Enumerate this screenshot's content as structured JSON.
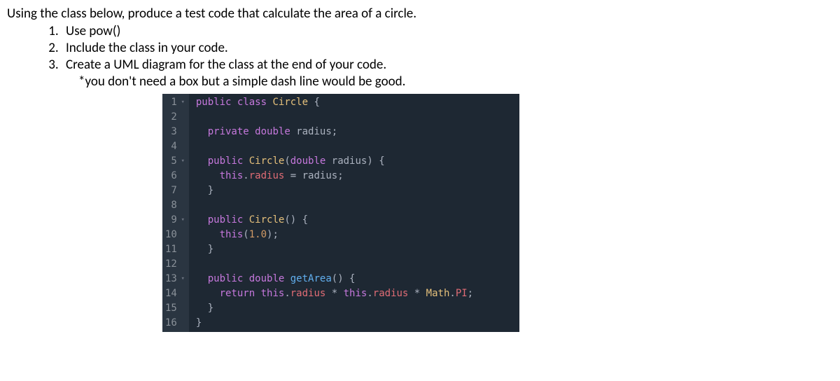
{
  "instruction": "Using the class below, produce a test code that calculate the area of a circle.",
  "list_items": [
    "Use pow()",
    "Include the class in your code.",
    "Create a UML diagram for the class at the end of your code."
  ],
  "note": "*you don't need a box but a simple dash line would be good.",
  "code": {
    "lines": [
      {
        "num": "1",
        "fold": true,
        "tokens": [
          {
            "t": "public",
            "c": "kw"
          },
          {
            "t": " ",
            "c": ""
          },
          {
            "t": "class",
            "c": "kw"
          },
          {
            "t": " ",
            "c": ""
          },
          {
            "t": "Circle",
            "c": "cls"
          },
          {
            "t": " {",
            "c": "punct"
          }
        ]
      },
      {
        "num": "2",
        "fold": false,
        "tokens": []
      },
      {
        "num": "3",
        "fold": false,
        "tokens": [
          {
            "t": "  ",
            "c": ""
          },
          {
            "t": "private",
            "c": "kw"
          },
          {
            "t": " ",
            "c": ""
          },
          {
            "t": "double",
            "c": "type"
          },
          {
            "t": " ",
            "c": ""
          },
          {
            "t": "radius",
            "c": "ident"
          },
          {
            "t": ";",
            "c": "punct"
          }
        ]
      },
      {
        "num": "4",
        "fold": false,
        "tokens": []
      },
      {
        "num": "5",
        "fold": true,
        "tokens": [
          {
            "t": "  ",
            "c": ""
          },
          {
            "t": "public",
            "c": "kw"
          },
          {
            "t": " ",
            "c": ""
          },
          {
            "t": "Circle",
            "c": "cls"
          },
          {
            "t": "(",
            "c": "punct"
          },
          {
            "t": "double",
            "c": "type"
          },
          {
            "t": " ",
            "c": ""
          },
          {
            "t": "radius",
            "c": "ident"
          },
          {
            "t": ") {",
            "c": "punct"
          }
        ]
      },
      {
        "num": "6",
        "fold": false,
        "tokens": [
          {
            "t": "    ",
            "c": ""
          },
          {
            "t": "this",
            "c": "this"
          },
          {
            "t": ".",
            "c": "punct"
          },
          {
            "t": "radius",
            "c": "prop"
          },
          {
            "t": " = ",
            "c": "punct"
          },
          {
            "t": "radius",
            "c": "ident"
          },
          {
            "t": ";",
            "c": "punct"
          }
        ]
      },
      {
        "num": "7",
        "fold": false,
        "tokens": [
          {
            "t": "  }",
            "c": "punct"
          }
        ]
      },
      {
        "num": "8",
        "fold": false,
        "tokens": []
      },
      {
        "num": "9",
        "fold": true,
        "tokens": [
          {
            "t": "  ",
            "c": ""
          },
          {
            "t": "public",
            "c": "kw"
          },
          {
            "t": " ",
            "c": ""
          },
          {
            "t": "Circle",
            "c": "cls"
          },
          {
            "t": "() {",
            "c": "punct"
          }
        ]
      },
      {
        "num": "10",
        "fold": false,
        "tokens": [
          {
            "t": "    ",
            "c": ""
          },
          {
            "t": "this",
            "c": "this"
          },
          {
            "t": "(",
            "c": "punct"
          },
          {
            "t": "1.0",
            "c": "num"
          },
          {
            "t": ");",
            "c": "punct"
          }
        ]
      },
      {
        "num": "11",
        "fold": false,
        "tokens": [
          {
            "t": "  }",
            "c": "punct"
          }
        ]
      },
      {
        "num": "12",
        "fold": false,
        "tokens": []
      },
      {
        "num": "13",
        "fold": true,
        "tokens": [
          {
            "t": "  ",
            "c": ""
          },
          {
            "t": "public",
            "c": "kw"
          },
          {
            "t": " ",
            "c": ""
          },
          {
            "t": "double",
            "c": "type"
          },
          {
            "t": " ",
            "c": ""
          },
          {
            "t": "getArea",
            "c": "method"
          },
          {
            "t": "() {",
            "c": "punct"
          }
        ]
      },
      {
        "num": "14",
        "fold": false,
        "tokens": [
          {
            "t": "    ",
            "c": ""
          },
          {
            "t": "return",
            "c": "kw"
          },
          {
            "t": " ",
            "c": ""
          },
          {
            "t": "this",
            "c": "this"
          },
          {
            "t": ".",
            "c": "punct"
          },
          {
            "t": "radius",
            "c": "prop"
          },
          {
            "t": " * ",
            "c": "punct"
          },
          {
            "t": "this",
            "c": "this"
          },
          {
            "t": ".",
            "c": "punct"
          },
          {
            "t": "radius",
            "c": "prop"
          },
          {
            "t": " * ",
            "c": "punct"
          },
          {
            "t": "Math",
            "c": "cls"
          },
          {
            "t": ".",
            "c": "punct"
          },
          {
            "t": "PI",
            "c": "prop"
          },
          {
            "t": ";",
            "c": "punct"
          }
        ]
      },
      {
        "num": "15",
        "fold": false,
        "tokens": [
          {
            "t": "  }",
            "c": "punct"
          }
        ]
      },
      {
        "num": "16",
        "fold": false,
        "tokens": [
          {
            "t": "}",
            "c": "punct"
          }
        ]
      }
    ]
  }
}
